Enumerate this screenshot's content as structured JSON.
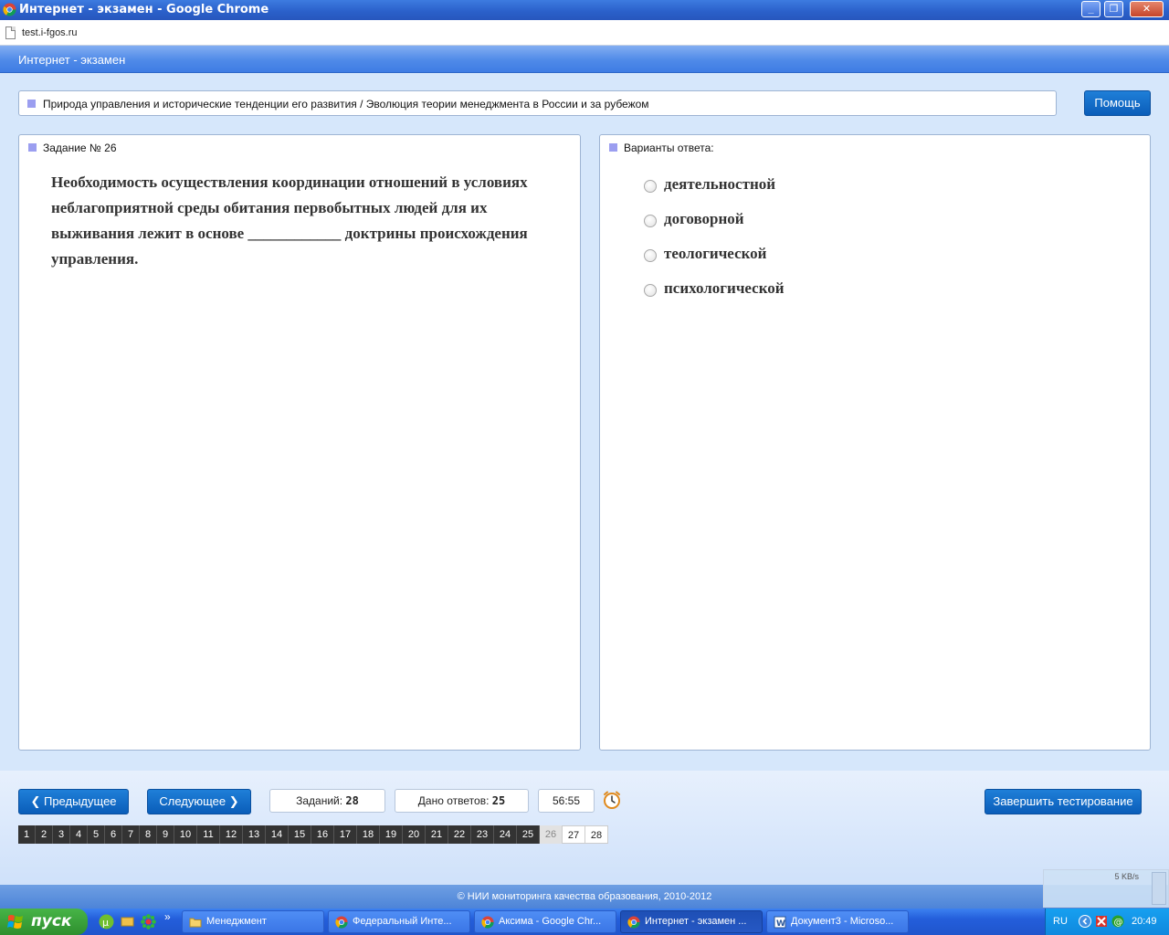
{
  "window": {
    "title": "Интернет - экзамен - Google Chrome",
    "url": "test.i-fgos.ru",
    "minimize": "_",
    "restore": "❐",
    "close": "✕"
  },
  "app": {
    "title": "Интернет - экзамен",
    "breadcrumb": "Природа управления и исторические тенденции его развития / Эволюция теории менеджмента в России и за рубежом",
    "help_label": "Помощь"
  },
  "question": {
    "header": "Задание № 26",
    "text": "Необходимость осуществления координации отношений в условиях неблагоприятной среды обитания первобытных людей для их выживания лежит в основе ____________ доктрины происхождения управления."
  },
  "answers": {
    "header": "Варианты ответа:",
    "options": [
      "деятельностной",
      "договорной",
      "теологической",
      "психологической"
    ]
  },
  "nav": {
    "prev_label": "Предыдущее",
    "next_label": "Следующее",
    "tasks_label": "Заданий:",
    "tasks_count": "28",
    "answered_label": "Дано ответов:",
    "answered_count": "25",
    "timer": "56:55",
    "finish_label": "Завершить тестирование",
    "pages": [
      "1",
      "2",
      "3",
      "4",
      "5",
      "6",
      "7",
      "8",
      "9",
      "10",
      "11",
      "12",
      "13",
      "14",
      "15",
      "16",
      "17",
      "18",
      "19",
      "20",
      "21",
      "22",
      "23",
      "24",
      "25",
      "26",
      "27",
      "28"
    ],
    "current_page": "26",
    "answered_pages": 25
  },
  "footer": {
    "copyright": "© НИИ мониторинга качества образования, 2010-2012",
    "net_rate": "5 KB/s"
  },
  "taskbar": {
    "start_label": "пуск",
    "more": "»",
    "tasks": [
      {
        "label": "Менеджмент",
        "icon": "folder-icon"
      },
      {
        "label": "Федеральный Инте...",
        "icon": "chrome-icon"
      },
      {
        "label": "Аксима - Google Chr...",
        "icon": "chrome-icon"
      },
      {
        "label": "Интернет - экзамен ...",
        "icon": "chrome-icon"
      },
      {
        "label": "Документ3 - Microso...",
        "icon": "word-icon"
      }
    ],
    "active_task": 3,
    "lang": "RU",
    "time": "20:49"
  },
  "colors": {
    "accent": "#0a5db9",
    "header": "#4f8ae8",
    "marker": "#9b9ef0"
  }
}
